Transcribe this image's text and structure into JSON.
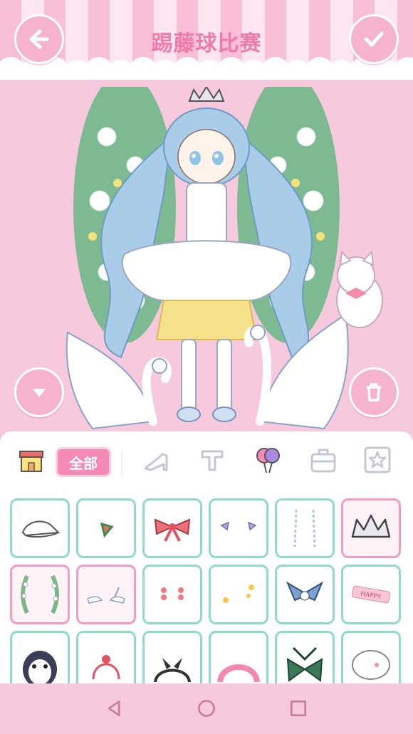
{
  "header": {
    "title": "踢藤球比赛"
  },
  "colors": {
    "accent": "#f48ab5",
    "background": "#f7c9dc",
    "cell_border": "#8fdcc6",
    "cell_selected_border": "#f59cc0"
  },
  "buttons": {
    "back": "back-arrow-icon",
    "confirm": "checkmark-icon",
    "collapse": "chevron-down-icon",
    "delete": "trash-icon"
  },
  "tabs": {
    "shop": "shop-icon",
    "all_label": "全部",
    "shoes": "shoe-icon",
    "top": "shirt-icon",
    "accessory": "balloon-icon",
    "bag": "bag-icon",
    "favorite": "star-icon"
  },
  "items": [
    {
      "icon": "cap-icon",
      "selected": false
    },
    {
      "icon": "watermelon-clip-icon",
      "selected": false
    },
    {
      "icon": "red-bow-icon",
      "selected": false
    },
    {
      "icon": "wing-clips-icon",
      "selected": false
    },
    {
      "icon": "earrings-icon",
      "selected": false
    },
    {
      "icon": "crown-icon",
      "selected": true
    },
    {
      "icon": "lily-garland-icon",
      "selected": true
    },
    {
      "icon": "swans-icon",
      "selected": true
    },
    {
      "icon": "red-earrings-icon",
      "selected": false
    },
    {
      "icon": "sparkle-icon",
      "selected": false
    },
    {
      "icon": "sailor-collar-icon",
      "selected": false
    },
    {
      "icon": "happy-sticker-icon",
      "selected": false
    },
    {
      "icon": "penguin-icon",
      "selected": false
    },
    {
      "icon": "red-headband-icon",
      "selected": false
    },
    {
      "icon": "black-bow-headband-icon",
      "selected": false
    },
    {
      "icon": "pink-headband-icon",
      "selected": false
    },
    {
      "icon": "green-bow-tie-icon",
      "selected": false
    },
    {
      "icon": "sheep-hat-icon",
      "selected": false
    }
  ],
  "sticker_text": "HAPPY",
  "nav": {
    "back": "nav-back-icon",
    "home": "nav-home-icon",
    "recents": "nav-recents-icon"
  }
}
